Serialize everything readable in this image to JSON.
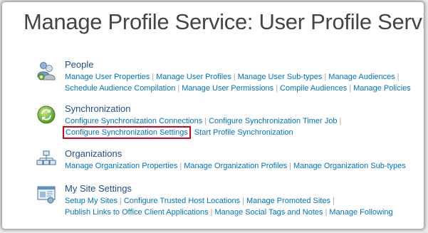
{
  "page": {
    "title": "Manage Profile Service: User Profile Service"
  },
  "sections": {
    "people": {
      "title": "People",
      "icon": "people-icon",
      "rows": [
        [
          "Manage User Properties",
          "Manage User Profiles",
          "Manage User Sub-types",
          "Manage Audiences"
        ],
        [
          "Schedule Audience Compilation",
          "Manage User Permissions",
          "Compile Audiences",
          "Manage Policies"
        ]
      ]
    },
    "sync": {
      "title": "Synchronization",
      "icon": "sync-icon",
      "rows": [
        [
          "Configure Synchronization Connections",
          "Configure Synchronization Timer Job"
        ],
        [
          "Configure Synchronization Settings",
          "Start Profile Synchronization"
        ]
      ],
      "highlighted_link": "Configure Synchronization Settings",
      "highlight_color": "#d9001b"
    },
    "organizations": {
      "title": "Organizations",
      "icon": "org-chart-icon",
      "rows": [
        [
          "Manage Organization Properties",
          "Manage Organization Profiles",
          "Manage Organization Sub-types"
        ]
      ]
    },
    "mysite": {
      "title": "My Site Settings",
      "icon": "my-site-icon",
      "rows": [
        [
          "Setup My Sites",
          "Configure Trusted Host Locations",
          "Manage Promoted Sites"
        ],
        [
          "Publish Links to Office Client Applications",
          "Manage Social Tags and Notes",
          "Manage Following"
        ]
      ]
    }
  },
  "separator": "|",
  "colors": {
    "link": "#0072c6",
    "section_title": "#1f4e8c",
    "page_title": "#444444"
  }
}
